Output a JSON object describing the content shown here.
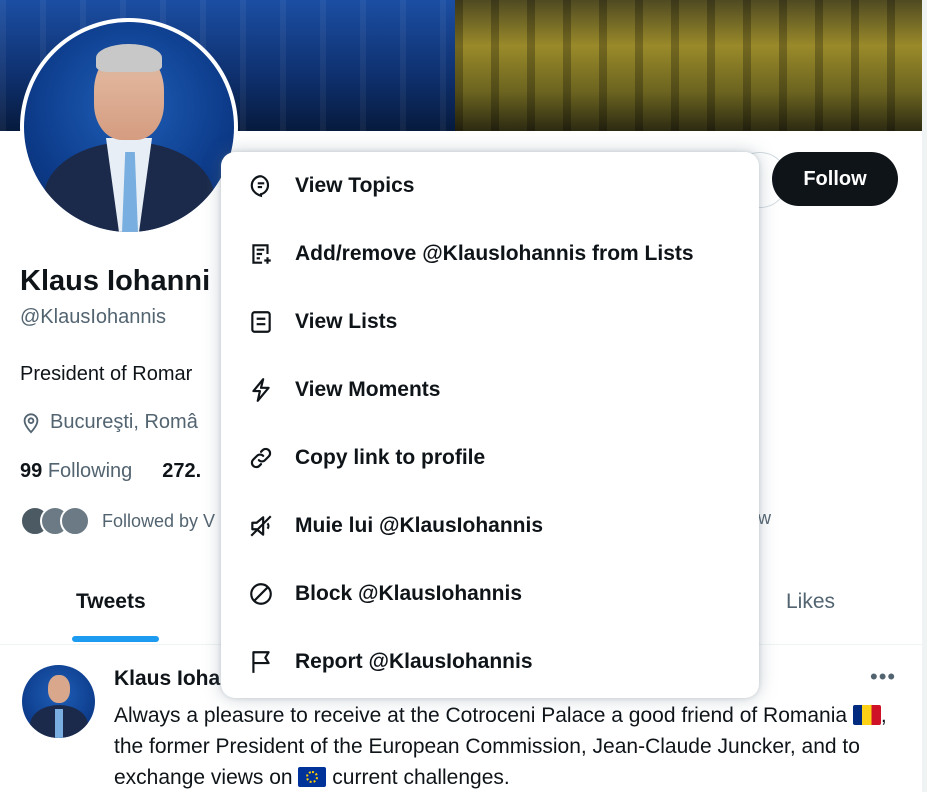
{
  "profile": {
    "name": "Klaus Iohanni",
    "handle": "@KlausIohannis",
    "bio": "President of Romar",
    "location": "Bucureşti, Româ",
    "following_count": "99",
    "following_label": "Following",
    "followers_count": "272.",
    "followed_by": "Followed by V",
    "followed_by_trailing": "w",
    "follow_button": "Follow"
  },
  "tabs": {
    "tweets": "Tweets",
    "likes": "Likes"
  },
  "menu": {
    "items": [
      {
        "label": "View Topics",
        "icon": "topics-icon"
      },
      {
        "label": "Add/remove @KlausIohannis from Lists",
        "icon": "list-add-icon"
      },
      {
        "label": "View Lists",
        "icon": "lists-icon"
      },
      {
        "label": "View Moments",
        "icon": "moments-icon"
      },
      {
        "label": "Copy link to profile",
        "icon": "link-icon"
      },
      {
        "label": "Muie lui @KlausIohannis",
        "icon": "mute-icon"
      },
      {
        "label": "Block @KlausIohannis",
        "icon": "block-icon"
      },
      {
        "label": "Report @KlausIohannis",
        "icon": "flag-icon"
      }
    ]
  },
  "tweet": {
    "author": "Klaus Ioha",
    "more": "•••",
    "text_1": "Always a pleasure to receive at the Cotroceni Palace a good friend of Romania ",
    "text_2": ", the former President of the European Commission, Jean-Claude Juncker, and to exchange views on ",
    "text_3": " current challenges."
  },
  "colors": {
    "accent": "#1d9bf0",
    "text_primary": "#0f1419",
    "text_secondary": "#536471"
  }
}
